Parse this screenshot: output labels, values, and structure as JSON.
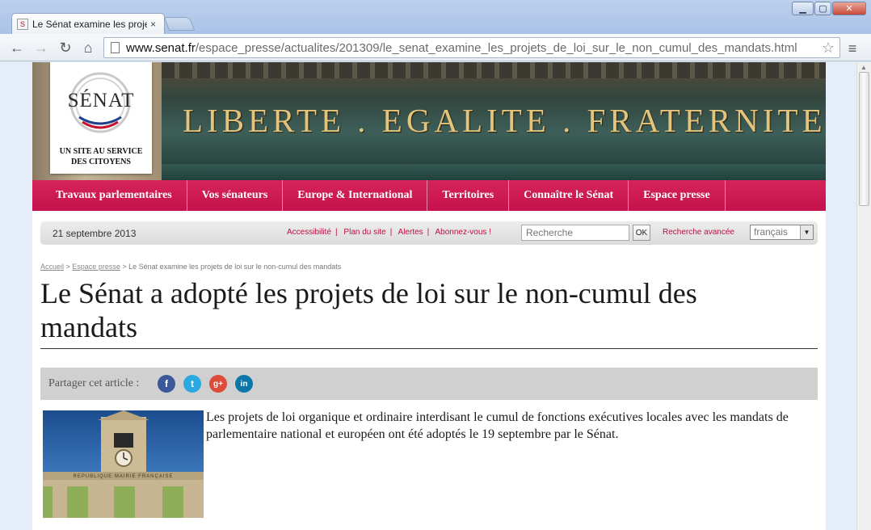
{
  "browser": {
    "tab_title": "Le Sénat examine les proje",
    "tab_close": "×",
    "url_host": "www.senat.fr",
    "url_path": "/espace_presse/actualites/201309/le_senat_examine_les_projets_de_loi_sur_le_non_cumul_des_mandats.html",
    "icons": [
      "back-arrow-icon",
      "forward-arrow-icon",
      "reload-icon",
      "home-icon",
      "star-icon",
      "menu-icon"
    ]
  },
  "header": {
    "logo_word": "SÉNAT",
    "logo_tagline_1": "UN SITE AU SERVICE",
    "logo_tagline_2": "DES CITOYENS",
    "motto": "LIBERTE . EGALITE . FRATERNITE"
  },
  "nav": {
    "items": [
      "Travaux parlementaires",
      "Vos sénateurs",
      "Europe & International",
      "Territoires",
      "Connaître le Sénat",
      "Espace presse"
    ]
  },
  "utility": {
    "date": "21 septembre 2013",
    "links": [
      "Accessibilité",
      "Plan du site",
      "Alertes",
      "Abonnez-vous !"
    ],
    "search_placeholder": "Recherche",
    "ok_label": "OK",
    "advanced_search": "Recherche avancée",
    "language": "français"
  },
  "breadcrumb": {
    "home": "Accueil",
    "section": "Espace presse",
    "current": "Le Sénat examine les projets de loi sur le non-cumul des mandats"
  },
  "article": {
    "title": "Le Sénat a adopté les projets de loi sur le non-cumul des mandats",
    "share_label": "Partager cet article :",
    "share_buttons": [
      "f",
      "t",
      "g+",
      "in"
    ],
    "lead": "Les projets de loi organique et ordinaire interdisant le cumul de fonctions exécutives locales avec les mandats de parlementaire national et européen ont été adoptés le 19 septembre par le Sénat.",
    "image_caption_text": "REPUBLIQUE  MAIRIE  FRANÇAISE"
  },
  "colors": {
    "nav_magenta": "#c5114c",
    "link_red": "#b8123f",
    "motto_gold": "#e3c47e",
    "facebook": "#3b5998",
    "twitter": "#2aa9e0",
    "googleplus": "#dd4b39",
    "linkedin": "#0e76a8"
  }
}
